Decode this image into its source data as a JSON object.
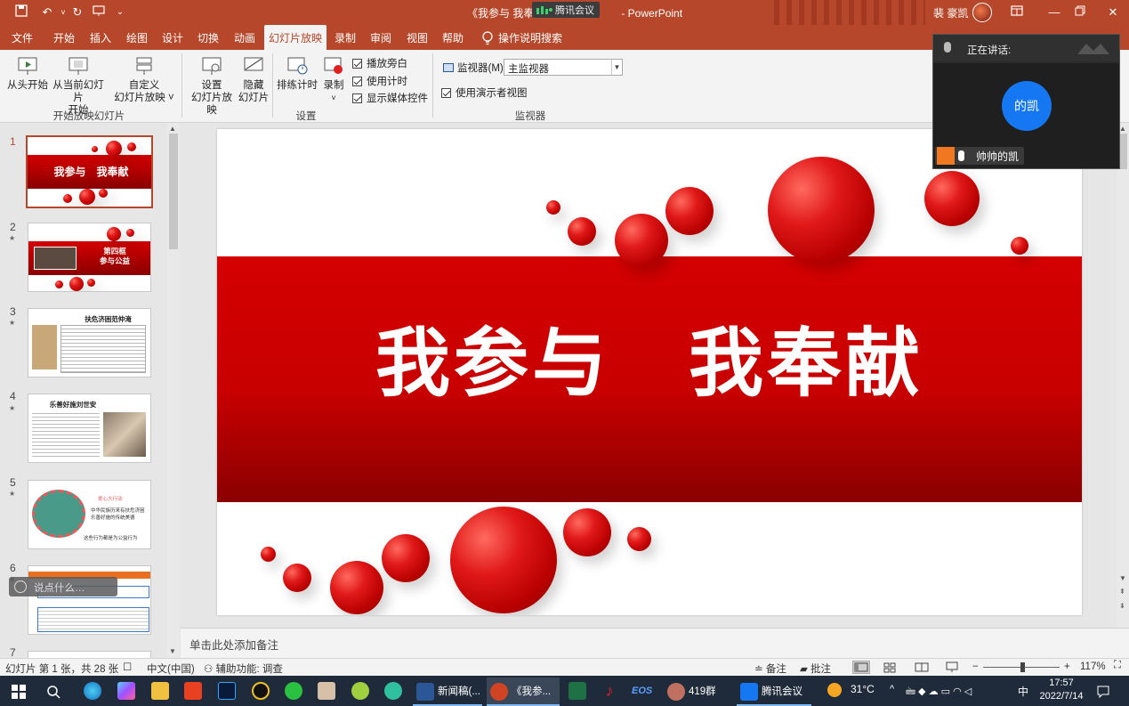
{
  "titlebar": {
    "title": "《我参与 我奉献",
    "app": "- PowerPoint",
    "meeting_chip": "腾讯会议",
    "user": "裴 豪凯",
    "colors": {
      "accent": "#b7472a"
    }
  },
  "tabs": [
    "文件",
    "开始",
    "插入",
    "绘图",
    "设计",
    "切换",
    "动画",
    "幻灯片放映",
    "录制",
    "审阅",
    "视图",
    "帮助"
  ],
  "active_tab": "幻灯片放映",
  "tell_me": "操作说明搜索",
  "ribbon": {
    "start_group": {
      "from_beginning": "从头开始",
      "from_current_line1": "从当前幻灯片",
      "from_current_line2": "开始",
      "custom_line1": "自定义",
      "custom_line2": "幻灯片放映 ˅",
      "label": "开始放映幻灯片"
    },
    "setup_group": {
      "setup_line1": "设置",
      "setup_line2": "幻灯片放映",
      "hide_line1": "隐藏",
      "hide_line2": "幻灯片",
      "rehearse": "排练计时",
      "record": "录制",
      "record_dd": "˅",
      "play_narrations": "播放旁白",
      "use_timings": "使用计时",
      "show_media_controls": "显示媒体控件",
      "label": "设置"
    },
    "monitor_group": {
      "monitor_label": "监视器(M):",
      "monitor_value": "主监视器",
      "presenter_view": "使用演示者视图",
      "label": "监视器"
    }
  },
  "meeting": {
    "speaking_label": "正在讲话:",
    "avatar_text": "的凯",
    "participant": "帅帅的凯"
  },
  "thumbnails": [
    {
      "num": "1",
      "title": "我参与　我奉献"
    },
    {
      "num": "2",
      "title_line1": "第四框",
      "title_line2": "参与公益"
    },
    {
      "num": "3",
      "title": "扶危济困范仲淹"
    },
    {
      "num": "4",
      "title": "乐善好施刘世安"
    },
    {
      "num": "5",
      "title": "爱心大行动",
      "caption1": "中华民族历来有扶危济困",
      "caption2": "乐善好施的传统美德",
      "caption3": "这些行为都是为公益行为"
    },
    {
      "num": "6"
    },
    {
      "num": "7"
    }
  ],
  "talk_pill": "说点什么…",
  "slide": {
    "title": "我参与　我奉献"
  },
  "notes_placeholder": "单击此处添加备注",
  "statusbar": {
    "slide_info": "幻灯片 第 1 张，共 28 张",
    "language": "中文(中国)",
    "accessibility": "辅助功能: 调查",
    "notes": "备注",
    "comments": "批注",
    "zoom_minus": "−",
    "zoom_plus": "+",
    "zoom": "117%",
    "zoom_level": 1.17
  },
  "taskbar": {
    "apps": [
      "新闻稿(...",
      "《我参...",
      "419群",
      "腾讯会议"
    ],
    "weather": "31°C",
    "time": "17:57",
    "date": "2022/7/14",
    "ime": "中",
    "eos": "EOS"
  }
}
